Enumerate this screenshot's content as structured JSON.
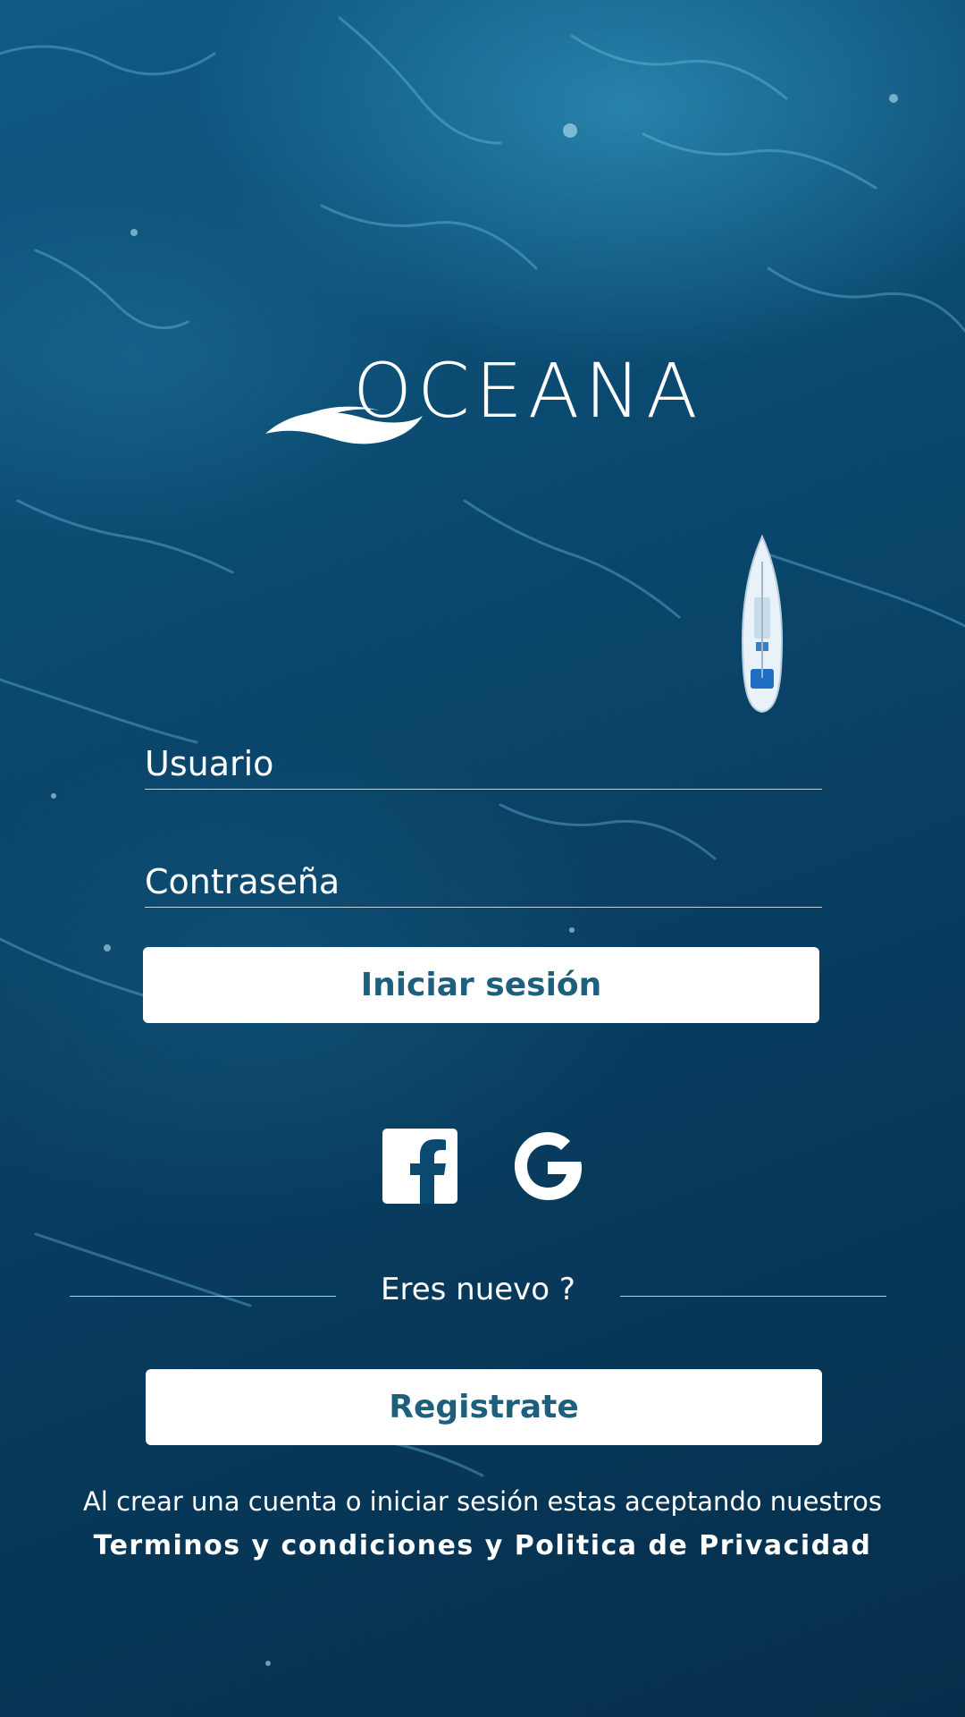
{
  "brand": {
    "name": "OCEANA"
  },
  "form": {
    "username_placeholder": "Usuario",
    "password_placeholder": "Contraseña",
    "login_label": "Iniciar sesión"
  },
  "social": {
    "facebook_icon": "facebook-icon",
    "google_icon": "google-icon"
  },
  "register": {
    "divider_text": "Eres nuevo ?",
    "button_label": "Registrate"
  },
  "legal": {
    "line1": "Al crear una cuenta o iniciar sesión estas aceptando nuestros",
    "line2": "Terminos y condiciones y Politica de Privacidad"
  },
  "colors": {
    "accent_text": "#1d5f7d",
    "background_dark": "#062e4b",
    "background_light": "#0f5a84"
  }
}
